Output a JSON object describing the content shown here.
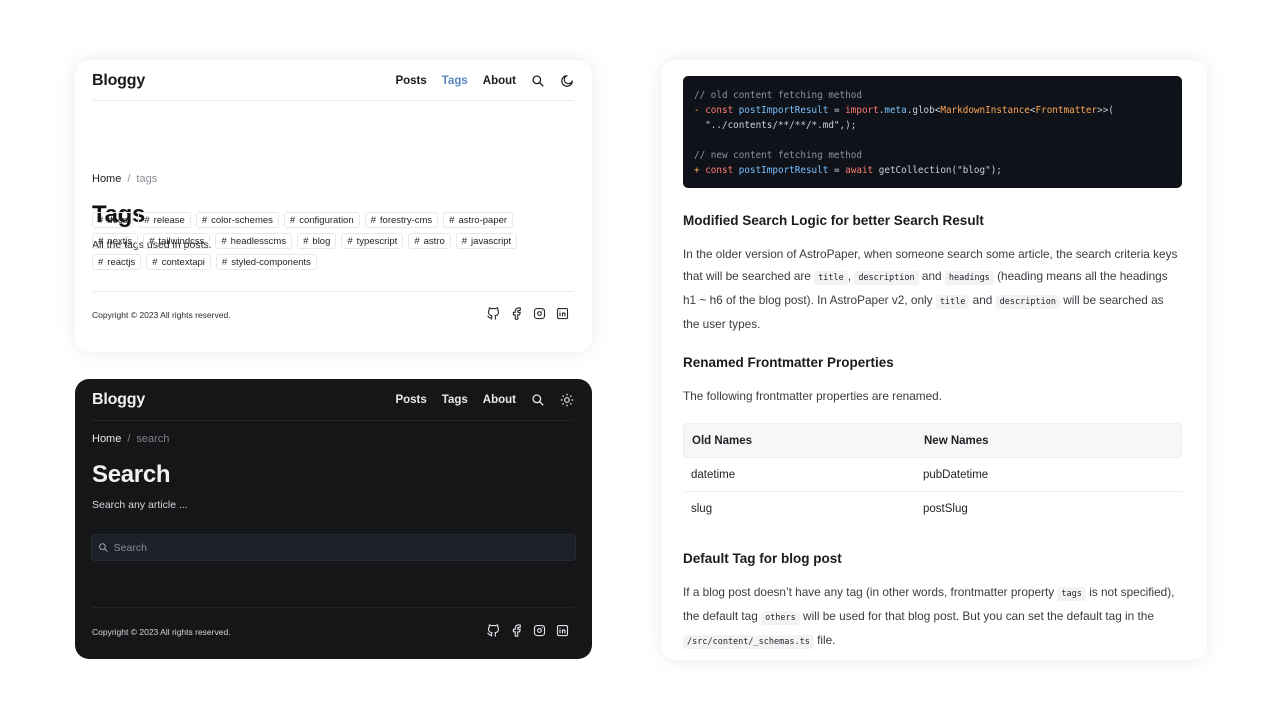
{
  "light_page": {
    "logo": "Bloggy",
    "nav": [
      {
        "label": "Posts",
        "active": false
      },
      {
        "label": "Tags",
        "active": true
      },
      {
        "label": "About",
        "active": false
      }
    ],
    "nav_icons": [
      "search-icon",
      "moon-icon"
    ],
    "breadcrumb": {
      "home": "Home",
      "separator": "/",
      "current": "tags"
    },
    "title": "Tags",
    "description": "All the tags used in posts.",
    "tag_prefix": "#",
    "tags": [
      "docs",
      "release",
      "color-schemes",
      "configuration",
      "forestry-cms",
      "astro-paper",
      "nextjs",
      "tailwindcss",
      "headlesscms",
      "blog",
      "typescript",
      "astro",
      "javascript",
      "reactjs",
      "contextapi",
      "styled-components"
    ],
    "footer": {
      "copyright": "Copyright © 2023 All rights reserved."
    },
    "socials": [
      "github-icon",
      "facebook-icon",
      "instagram-icon",
      "linkedin-icon"
    ],
    "accent_color": "#5a85c0"
  },
  "dark_page": {
    "logo": "Bloggy",
    "nav": [
      {
        "label": "Posts"
      },
      {
        "label": "Tags"
      },
      {
        "label": "About"
      }
    ],
    "nav_icons": [
      "search-icon",
      "sun-icon"
    ],
    "breadcrumb": {
      "home": "Home",
      "separator": "/",
      "current": "search"
    },
    "title": "Search",
    "description": "Search any article ...",
    "search": {
      "placeholder": "Search",
      "value": ""
    },
    "footer": {
      "copyright": "Copyright © 2023 All rights reserved."
    },
    "socials": [
      "github-icon",
      "facebook-icon",
      "instagram-icon",
      "linkedin-icon"
    ]
  },
  "article": {
    "code_lines": [
      [
        {
          "t": "// old content fetching method",
          "c": "com"
        }
      ],
      [
        {
          "t": "- ",
          "c": "del"
        },
        {
          "t": "const ",
          "c": "kw"
        },
        {
          "t": "postImportResult",
          "c": "var"
        },
        {
          "t": " = ",
          "c": "plain"
        },
        {
          "t": "import",
          "c": "kw"
        },
        {
          "t": ".",
          "c": "plain"
        },
        {
          "t": "meta",
          "c": "var"
        },
        {
          "t": ".glob<",
          "c": "plain"
        },
        {
          "t": "MarkdownInstance",
          "c": "type"
        },
        {
          "t": "<",
          "c": "plain"
        },
        {
          "t": "Frontmatter",
          "c": "type"
        },
        {
          "t": ">>(",
          "c": "plain"
        }
      ],
      [
        {
          "t": "  \"../contents/**/**/*.md\",);",
          "c": "plain"
        }
      ],
      [
        {
          "t": "",
          "c": "plain"
        }
      ],
      [
        {
          "t": "// new content fetching method",
          "c": "com"
        }
      ],
      [
        {
          "t": "+ ",
          "c": "add"
        },
        {
          "t": "const ",
          "c": "kw"
        },
        {
          "t": "postImportResult",
          "c": "var"
        },
        {
          "t": " = ",
          "c": "plain"
        },
        {
          "t": "await ",
          "c": "kw"
        },
        {
          "t": "getCollection(\"blog\");",
          "c": "plain"
        }
      ]
    ],
    "sections": [
      {
        "heading": "Modified Search Logic for better Search Result",
        "paragraph": [
          {
            "t": "In the older version of AstroPaper, when someone search some article, the search criteria keys that will be searched are "
          },
          {
            "code": "title"
          },
          {
            "t": ", "
          },
          {
            "code": "description"
          },
          {
            "t": " and "
          },
          {
            "code": "headings"
          },
          {
            "t": " (heading means all the headings h1 ~ h6 of the blog post). In AstroPaper v2, only "
          },
          {
            "code": "title"
          },
          {
            "t": " and "
          },
          {
            "code": "description"
          },
          {
            "t": " will be searched as the user types."
          }
        ]
      },
      {
        "heading": "Renamed Frontmatter Properties",
        "paragraph": [
          {
            "t": "The following frontmatter properties are renamed."
          }
        ]
      },
      {
        "heading": "Default Tag for blog post",
        "paragraph": [
          {
            "t": "If a blog post doesn’t have any tag (in other words, frontmatter property "
          },
          {
            "code": "tags"
          },
          {
            "t": " is not specified), the default tag "
          },
          {
            "code": "others"
          },
          {
            "t": " will be used for that blog post. But you can set the default tag in the "
          },
          {
            "code": "/src/content/_schemas.ts"
          },
          {
            "t": " file."
          }
        ]
      }
    ],
    "table": {
      "headers": [
        "Old Names",
        "New Names"
      ],
      "rows": [
        [
          "datetime",
          "pubDatetime"
        ],
        [
          "slug",
          "postSlug"
        ]
      ]
    }
  }
}
